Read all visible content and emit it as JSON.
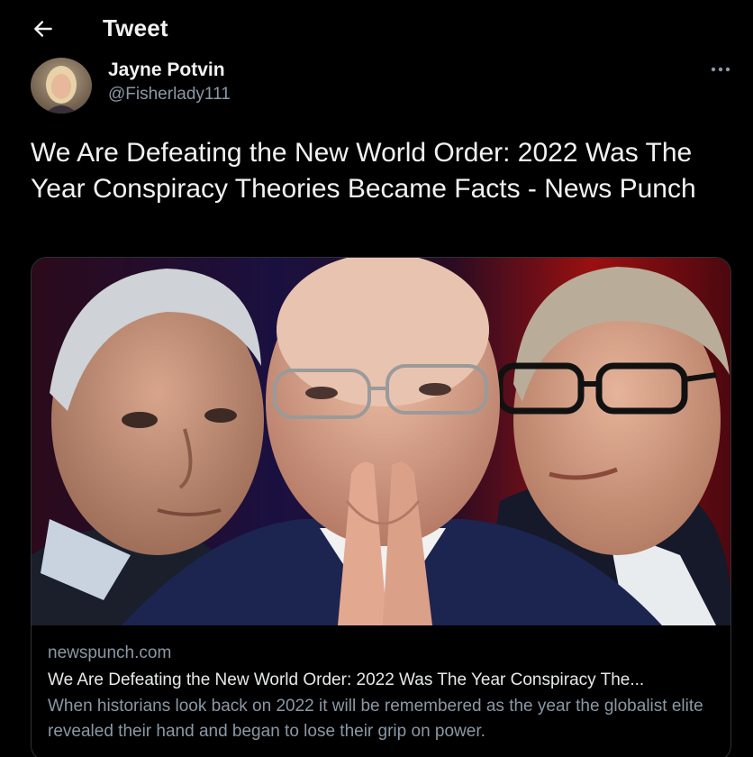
{
  "header": {
    "title": "Tweet"
  },
  "author": {
    "name": "Jayne Potvin",
    "handle": "@Fisherlady111"
  },
  "tweet": {
    "text": "We Are Defeating the New World Order: 2022 Was The Year Conspiracy Theories Became Facts - News Punch"
  },
  "link_card": {
    "domain": "newspunch.com",
    "title": "We Are Defeating the New World Order: 2022 Was The Year Conspiracy The...",
    "description": "When historians look back on 2022 it will be remembered as the year the globalist elite revealed their hand and began to lose their grip on power."
  },
  "icons": {
    "back": "arrow-left-icon",
    "more": "more-horizontal-icon"
  },
  "colors": {
    "background": "#000000",
    "text": "#e7e9ea",
    "secondary": "#8b98a5",
    "border": "#2f3336"
  }
}
